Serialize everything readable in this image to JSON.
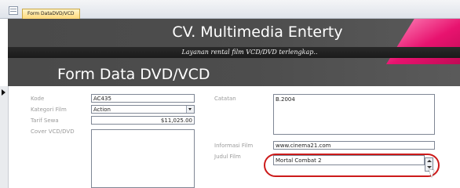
{
  "tab": {
    "label": "Form DataDVD/VCD"
  },
  "header": {
    "company": "CV. Multimedia Enterty",
    "tagline": "Layanan rental film VCD/DVD terlengkap..",
    "form_title": "Form Data DVD/VCD"
  },
  "fields": {
    "kode": {
      "label": "Kode",
      "value": "AC435"
    },
    "kategori": {
      "label": "Kategori Film",
      "value": "Action"
    },
    "tarif": {
      "label": "Tarif Sewa",
      "value": "$11,025.00"
    },
    "cover": {
      "label": "Cover VCD/DVD"
    },
    "catatan": {
      "label": "Catatan",
      "value": "B.2004"
    },
    "informasi": {
      "label": "Informasi Film",
      "value": "www.cinema21.com"
    },
    "judul": {
      "label": "Judul Film",
      "value": "Mortal Combat 2"
    }
  },
  "colors": {
    "header_bg": "#4d4d4d",
    "accent_pink": "#e8136f",
    "highlight_oval": "#cc1a1a",
    "tab_bg": "#ffd97a"
  },
  "icons": {
    "tab": "form-icon",
    "record": "record-selector-arrow-icon",
    "dropdown": "chevron-down-icon",
    "spinner": "spinner-icon",
    "cursor": "mouse-pointer-icon"
  }
}
